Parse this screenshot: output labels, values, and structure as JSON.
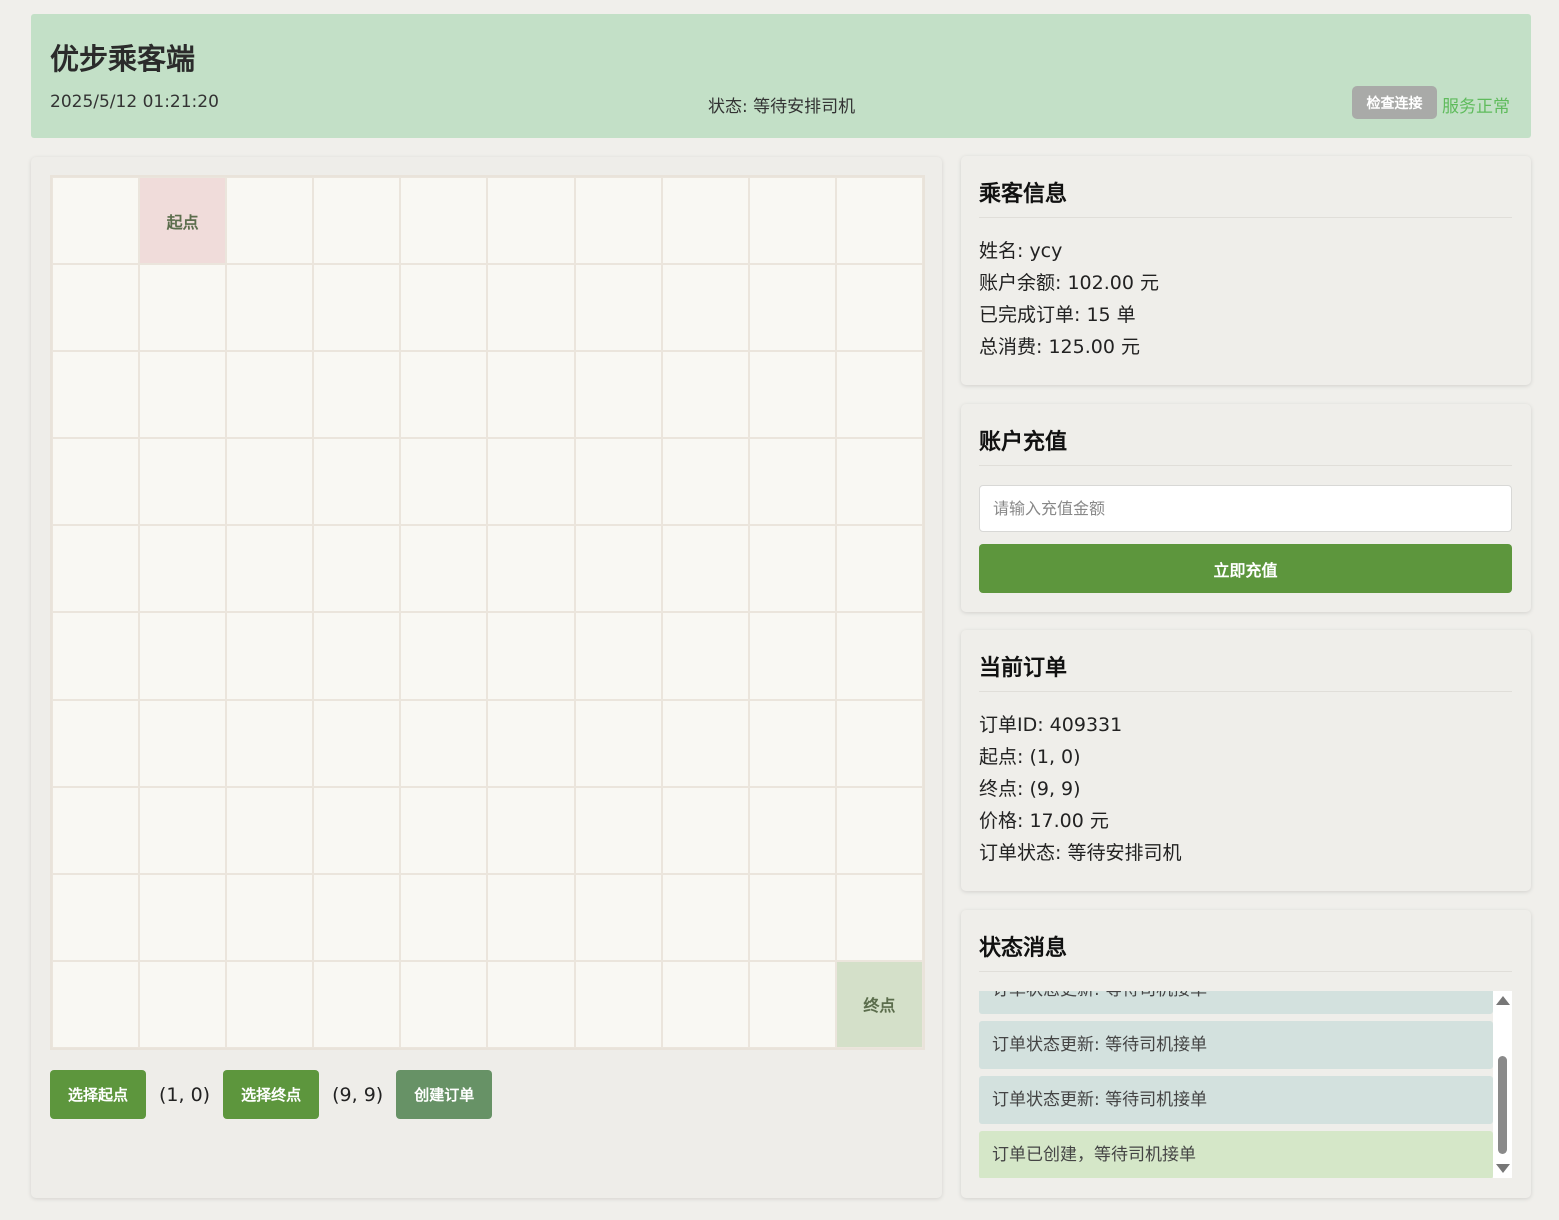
{
  "header": {
    "title": "优步乘客端",
    "datetime": "2025/5/12 01:21:20",
    "status": "状态: 等待安排司机",
    "check_button": "检查连接",
    "service_status": "服务正常"
  },
  "map": {
    "rows": 10,
    "cols": 10,
    "start": {
      "x": 1,
      "y": 0,
      "label": "起点"
    },
    "end": {
      "x": 9,
      "y": 9,
      "label": "终点"
    },
    "select_start_button": "选择起点",
    "start_coord": "(1, 0)",
    "select_end_button": "选择终点",
    "end_coord": "(9, 9)",
    "create_order_button": "创建订单"
  },
  "passenger": {
    "title": "乘客信息",
    "name": "姓名: ycy",
    "balance": "账户余额: 102.00 元",
    "completed_orders": "已完成订单: 15 单",
    "total_spent": "总消费: 125.00 元"
  },
  "recharge": {
    "title": "账户充值",
    "placeholder": "请输入充值金额",
    "button": "立即充值"
  },
  "order": {
    "title": "当前订单",
    "id": "订单ID: 409331",
    "start": "起点: (1, 0)",
    "end": "终点: (9, 9)",
    "price": "价格: 17.00 元",
    "status": "订单状态: 等待安排司机"
  },
  "messages": {
    "title": "状态消息",
    "items": [
      "订单状态更新: 等待司机接单",
      "订单状态更新: 等待司机接单",
      "订单状态更新: 等待司机接单",
      "订单已创建，等待司机接单"
    ]
  }
}
